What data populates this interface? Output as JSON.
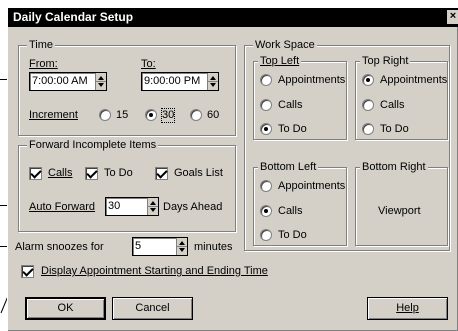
{
  "dialog": {
    "title": "Daily Calendar Setup",
    "close_glyph": "×"
  },
  "time": {
    "title": "Time",
    "from_label": "From:",
    "from_value": "7:00:00 AM",
    "to_label": "To:",
    "to_value": "9:00:00 PM",
    "increment_label": "Increment",
    "increments": [
      "15",
      "30",
      "60"
    ],
    "selected_increment": "30"
  },
  "forward": {
    "title": "Forward Incomplete Items",
    "calls_label": "Calls",
    "todo_label": "To Do",
    "goals_label": "Goals List",
    "auto_forward_label": "Auto Forward",
    "auto_forward_value": "30",
    "days_ahead_label": "Days Ahead"
  },
  "alarm": {
    "label": "Alarm snoozes for",
    "value": "5",
    "unit": "minutes"
  },
  "display_option": {
    "label": "Display Appointment Starting and Ending Time",
    "checked": true
  },
  "workspace": {
    "title": "Work Space",
    "top_left": {
      "title": "Top Left",
      "options": [
        "Appointments",
        "Calls",
        "To Do"
      ],
      "selected": "To Do"
    },
    "top_right": {
      "title": "Top Right",
      "options": [
        "Appointments",
        "Calls",
        "To Do"
      ],
      "selected": "Appointments"
    },
    "bottom_left": {
      "title": "Bottom Left",
      "options": [
        "Appointments",
        "Calls",
        "To Do"
      ],
      "selected": "Calls"
    },
    "bottom_right": {
      "title": "Bottom Right",
      "content": "Viewport"
    }
  },
  "buttons": {
    "ok": "OK",
    "cancel": "Cancel",
    "help": "Help"
  }
}
